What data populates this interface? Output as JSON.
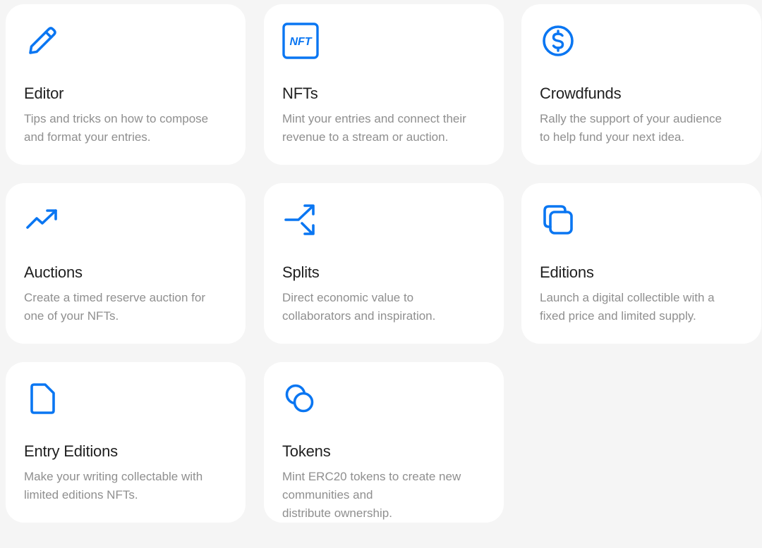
{
  "accent_color": "#0a76f2",
  "cards": [
    {
      "icon": "pencil-icon",
      "title": "Editor",
      "desc_lines": [
        "Tips and tricks on how to compose",
        "and format your entries."
      ]
    },
    {
      "icon": "nft-icon",
      "icon_text": "NFT",
      "title": "NFTs",
      "desc_lines": [
        "Mint your entries and connect their",
        "revenue to a stream or auction."
      ]
    },
    {
      "icon": "dollar-coin-icon",
      "title": "Crowdfunds",
      "desc_lines": [
        "Rally the support of your audience",
        "to help fund your next idea."
      ]
    },
    {
      "icon": "trending-up-icon",
      "title": "Auctions",
      "desc_lines": [
        "Create a timed reserve auction for",
        "one of your NFTs."
      ]
    },
    {
      "icon": "split-arrows-icon",
      "title": "Splits",
      "desc_lines": [
        "Direct economic value to",
        "collaborators and inspiration."
      ]
    },
    {
      "icon": "copy-squares-icon",
      "title": "Editions",
      "desc_lines": [
        "Launch a digital collectible with a",
        "fixed price and limited supply."
      ]
    },
    {
      "icon": "document-icon",
      "title": "Entry Editions",
      "desc_lines": [
        "Make your writing collectable with",
        "limited editions NFTs."
      ]
    },
    {
      "icon": "overlapping-circles-icon",
      "title": "Tokens",
      "desc_lines": [
        "Mint ERC20 tokens to create new",
        "communities and",
        "distribute ownership."
      ]
    }
  ]
}
